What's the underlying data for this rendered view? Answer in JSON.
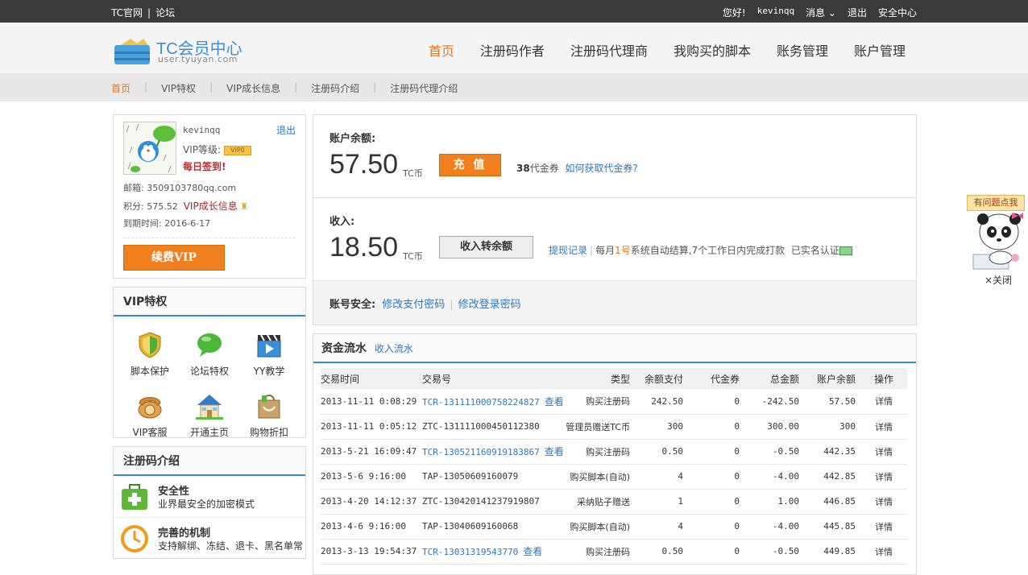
{
  "topbar": {
    "links": [
      "TC官网",
      "论坛"
    ],
    "greeting": "您好!",
    "username": "kevinqq",
    "messages": "消息",
    "logout": "退出",
    "security": "安全中心"
  },
  "header": {
    "logo_title": "TC会员中心",
    "logo_url": "user.tyuyan.com",
    "nav": [
      "首页",
      "注册码作者",
      "注册码代理商",
      "我购买的脚本",
      "账务管理",
      "账户管理"
    ]
  },
  "subnav": [
    "首页",
    "VIP特权",
    "VIP成长信息",
    "注册码介绍",
    "注册码代理介绍"
  ],
  "profile": {
    "username": "kevinqq",
    "logout": "退出",
    "vip_label": "VIP等级:",
    "vip_badge": "VIP0",
    "sign_in": "每日签到!",
    "email": "邮箱: 3509103780qq.com",
    "points": "积分: 575.52",
    "growth": "VIP成长信息",
    "expire": "到期时间: 2016-6-17",
    "renew": "续费VIP"
  },
  "vip_box": {
    "title": "VIP特权",
    "items": [
      {
        "label": "脚本保护",
        "icon": "shield-icon"
      },
      {
        "label": "论坛特权",
        "icon": "chat-bubble-icon"
      },
      {
        "label": "YY教学",
        "icon": "clapper-icon"
      },
      {
        "label": "VIP客服",
        "icon": "phone-icon"
      },
      {
        "label": "开通主页",
        "icon": "house-icon"
      },
      {
        "label": "购物折扣",
        "icon": "shopping-bag-icon"
      }
    ]
  },
  "intro_box": {
    "title": "注册码介绍",
    "items": [
      {
        "title": "安全性",
        "desc": "业界最安全的加密模式",
        "icon": "plus-kit-icon"
      },
      {
        "title": "完善的机制",
        "desc": "支持解绑、冻结、退卡、黑名单常",
        "icon": "clock-icon"
      }
    ]
  },
  "account": {
    "balance_label": "账户余额:",
    "balance": "57.50",
    "unit": "TC币",
    "recharge": "充 值",
    "coupon_count": "38",
    "coupon_label": "代金券",
    "coupon_link": "如何获取代金券?",
    "income_label": "收入:",
    "income": "18.50",
    "transfer": "收入转余额",
    "withdraw_link": "提现记录",
    "settle_pre": "每月",
    "settle_day": "1号",
    "settle_post": "系统自动结算,7个工作日内完成打款",
    "verified": "已实名认证",
    "security_label": "账号安全:",
    "change_pay_pwd": "修改支付密码",
    "change_login_pwd": "修改登录密码"
  },
  "flow": {
    "title": "资金流水",
    "tab_income": "收入流水",
    "view_label": "查看",
    "detail_label": "详情",
    "columns": [
      "交易时间",
      "交易号",
      "类型",
      "余额支付",
      "代金券",
      "总金额",
      "账户余额",
      "操作"
    ],
    "rows": [
      {
        "time": "2013-11-11 0:08:29",
        "id": "TCR-131111000758224827",
        "link": true,
        "type": "购买注册码",
        "pay": "242.50",
        "coupon": "0",
        "total": "-242.50",
        "sign": "neg",
        "balance": "57.50"
      },
      {
        "time": "2013-11-11 0:05:12",
        "id": "ZTC-131111000450112380",
        "link": false,
        "type": "管理员赠送TC币",
        "pay": "300",
        "coupon": "0",
        "total": "300.00",
        "sign": "pos",
        "balance": "300"
      },
      {
        "time": "2013-5-21 16:09:47",
        "id": "TCR-130521160919183867",
        "link": true,
        "type": "购买注册码",
        "pay": "0.50",
        "coupon": "0",
        "total": "-0.50",
        "sign": "neg",
        "balance": "442.35"
      },
      {
        "time": "2013-5-6  9:16:00",
        "id": "TAP-13050609160079",
        "link": false,
        "type": "购买脚本(自动)",
        "pay": "4",
        "coupon": "0",
        "total": "-4.00",
        "sign": "neg",
        "balance": "442.85"
      },
      {
        "time": "2013-4-20 14:12:37",
        "id": "ZTC-130420141237919807",
        "link": false,
        "type": "采纳贴子赠送",
        "pay": "1",
        "coupon": "0",
        "total": "1.00",
        "sign": "pos",
        "balance": "446.85"
      },
      {
        "time": "2013-4-6  9:16:00",
        "id": "TAP-13040609160068",
        "link": false,
        "type": "购买脚本(自动)",
        "pay": "4",
        "coupon": "0",
        "total": "-4.00",
        "sign": "neg",
        "balance": "445.85"
      },
      {
        "time": "2013-3-13 19:54:37",
        "id": "TCR-13031319543770",
        "link": true,
        "type": "购买注册码",
        "pay": "0.50",
        "coupon": "0",
        "total": "-0.50",
        "sign": "neg",
        "balance": "449.85"
      }
    ]
  },
  "floater": {
    "ask": "有问题点我",
    "close": "×关闭"
  }
}
